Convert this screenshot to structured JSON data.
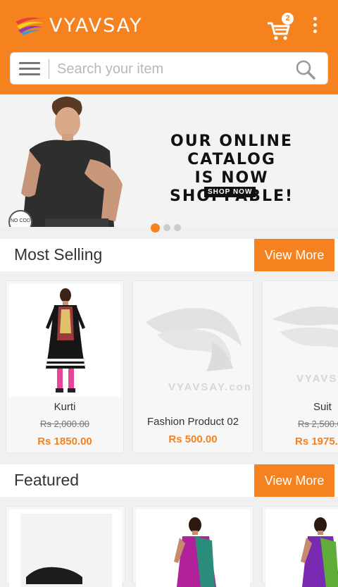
{
  "header": {
    "brand": "VYAVSAY",
    "cart_count": "2"
  },
  "search": {
    "placeholder": "Search your item"
  },
  "banner": {
    "headline_line1": "OUR ONLINE CATALOG",
    "headline_line2": "IS NOW SHOPPABLE!",
    "cta": "SHOP NOW",
    "badge": "NO COD",
    "carousel_total": 3,
    "carousel_active": 1
  },
  "sections": {
    "most_selling": {
      "title": "Most Selling",
      "view_more": "View More",
      "products": [
        {
          "name": "Kurti",
          "old_price": "Rs 2,000.00",
          "price": "Rs 1850.00"
        },
        {
          "name": "Fashion Product 02",
          "old_price": "",
          "price": "Rs 500.00",
          "watermark": "VYAVSAY.com"
        },
        {
          "name": "Suit",
          "old_price": "Rs 2,500.0",
          "price": "Rs 1975.",
          "watermark": "VYAVS"
        }
      ]
    },
    "featured": {
      "title": "Featured",
      "view_more": "View More"
    }
  },
  "colors": {
    "accent": "#f5821f",
    "background": "#f0f0f0"
  }
}
